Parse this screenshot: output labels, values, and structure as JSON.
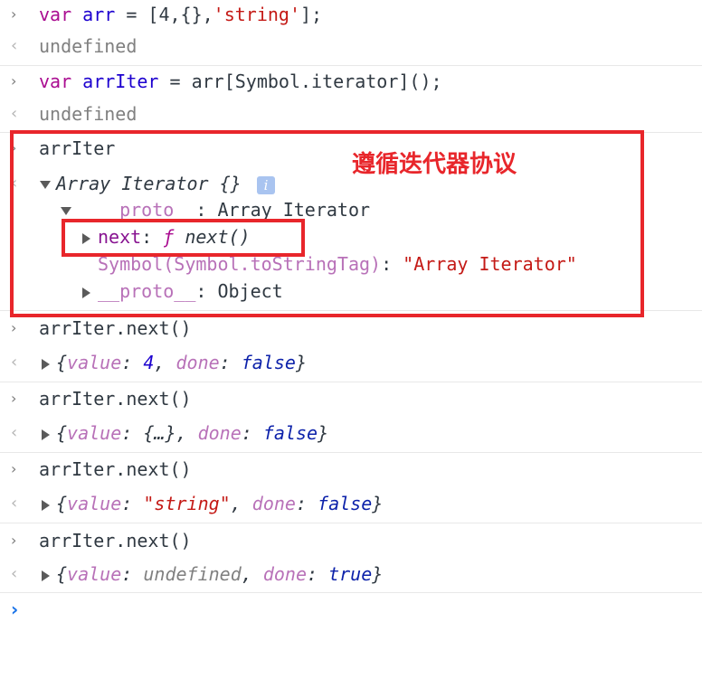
{
  "colors": {
    "keyword": "#aa0d91",
    "variable": "#1c00cf",
    "string": "#c41a16",
    "annotation": "#e8262b",
    "prompt": "#1a73e8"
  },
  "entries": [
    {
      "input": {
        "kw": "var",
        "name": "arr",
        "rest_pre": " = [4,{},",
        "str": "'string'",
        "rest_post": "];"
      },
      "output": "undefined"
    },
    {
      "input": {
        "kw": "var",
        "name": "arrIter",
        "rest_pre": " = arr[Symbol.iterator]();"
      },
      "output": "undefined"
    }
  ],
  "inspect": {
    "input": "arrIter",
    "object_label": "Array Iterator {}",
    "info_icon": "i",
    "proto_key": "__proto__",
    "proto_sep": ": ",
    "proto_value": "Array Iterator",
    "next_key": "next",
    "next_sep": ": ",
    "next_f": "ƒ",
    "next_value": " next()",
    "symbol_key": "Symbol(Symbol.toStringTag)",
    "symbol_sep": ": ",
    "symbol_value": "\"Array Iterator\"",
    "proto2_key": "__proto__",
    "proto2_sep": ": ",
    "proto2_value": "Object"
  },
  "annotation": {
    "label": "遵循迭代器协议"
  },
  "calls": [
    {
      "input": "arrIter.next()",
      "open": "{",
      "value_key": "value",
      "value": "4",
      "sep": ", ",
      "done_key": "done",
      "done": "false",
      "close": "}",
      "value_type": "number"
    },
    {
      "input": "arrIter.next()",
      "open": "{",
      "value_key": "value",
      "value": "{…}",
      "sep": ", ",
      "done_key": "done",
      "done": "false",
      "close": "}",
      "value_type": "object"
    },
    {
      "input": "arrIter.next()",
      "open": "{",
      "value_key": "value",
      "value": "\"string\"",
      "sep": ", ",
      "done_key": "done",
      "done": "false",
      "close": "}",
      "value_type": "string"
    },
    {
      "input": "arrIter.next()",
      "open": "{",
      "value_key": "value",
      "value": "undefined",
      "sep": ", ",
      "done_key": "done",
      "done": "true",
      "close": "}",
      "value_type": "undefined"
    }
  ],
  "icons": {
    "input_caret": "›",
    "output_caret": "‹",
    "prompt_caret": "›"
  }
}
